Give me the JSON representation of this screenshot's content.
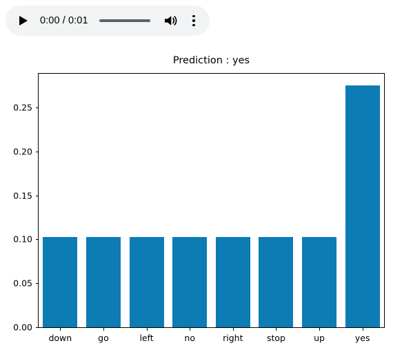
{
  "audio_player": {
    "play_label": "play-icon",
    "time_text": "0:00 / 0:01",
    "current_time": "0:00",
    "duration": "0:01",
    "progress_percent": 0,
    "volume_icon": "volume-high-icon",
    "menu_icon": "more-vertical-icon",
    "background_color": "#f1f3f4",
    "track_color": "#5f6368"
  },
  "chart_data": {
    "type": "bar",
    "title": "Prediction : yes",
    "xlabel": "",
    "ylabel": "",
    "categories": [
      "down",
      "go",
      "left",
      "no",
      "right",
      "stop",
      "up",
      "yes"
    ],
    "values": [
      0.103,
      0.103,
      0.103,
      0.103,
      0.103,
      0.103,
      0.103,
      0.275
    ],
    "ylim": [
      0.0,
      0.2884
    ],
    "yticks": [
      0.0,
      0.05,
      0.1,
      0.15,
      0.2,
      0.25
    ],
    "ytick_labels": [
      "0.00",
      "0.05",
      "0.10",
      "0.15",
      "0.20",
      "0.25"
    ],
    "grid": false,
    "legend": null,
    "bar_color": "#0d7cb5",
    "bar_width_fraction": 0.8
  }
}
